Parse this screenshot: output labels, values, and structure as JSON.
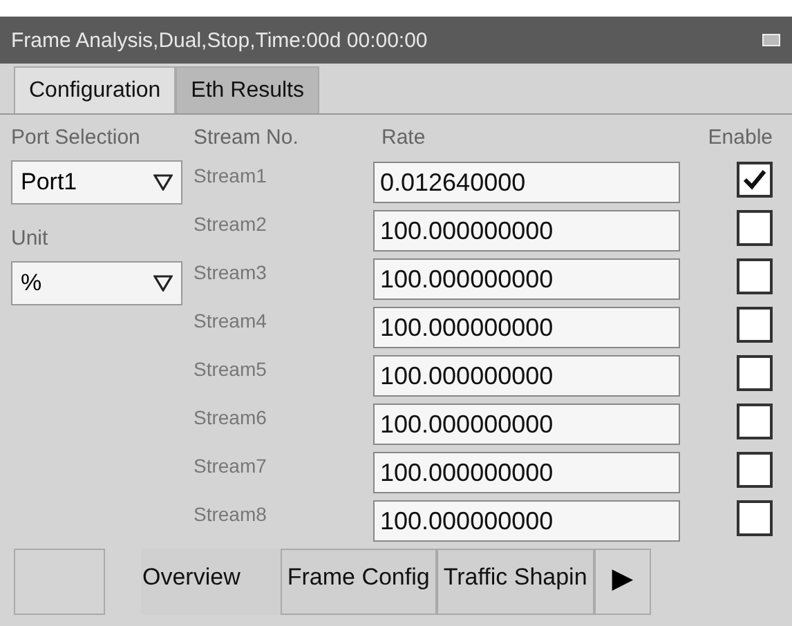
{
  "window": {
    "title": "Frame Analysis,Dual,Stop,Time:00d 00:00:00"
  },
  "tabs": [
    {
      "label": "Configuration",
      "selected": true
    },
    {
      "label": "Eth Results",
      "selected": false
    }
  ],
  "port_selection": {
    "label": "Port Selection",
    "value": "Port1"
  },
  "unit": {
    "label": "Unit",
    "value": "%"
  },
  "columns": {
    "stream": "Stream No.",
    "rate": "Rate",
    "enable": "Enable"
  },
  "streams": [
    {
      "name": "Stream1",
      "rate": "0.012640000",
      "checked": true
    },
    {
      "name": "Stream2",
      "rate": "100.000000000",
      "checked": false
    },
    {
      "name": "Stream3",
      "rate": "100.000000000",
      "checked": false
    },
    {
      "name": "Stream4",
      "rate": "100.000000000",
      "checked": false
    },
    {
      "name": "Stream5",
      "rate": "100.000000000",
      "checked": false
    },
    {
      "name": "Stream6",
      "rate": "100.000000000",
      "checked": false
    },
    {
      "name": "Stream7",
      "rate": "100.000000000",
      "checked": false
    },
    {
      "name": "Stream8",
      "rate": "100.000000000",
      "checked": false
    }
  ],
  "bottom_tabs": [
    {
      "label": "Overview",
      "selected": true
    },
    {
      "label": "Frame Config",
      "selected": false
    },
    {
      "label": "Traffic Shapin",
      "selected": false
    }
  ],
  "next_button": {
    "label": "▶"
  }
}
